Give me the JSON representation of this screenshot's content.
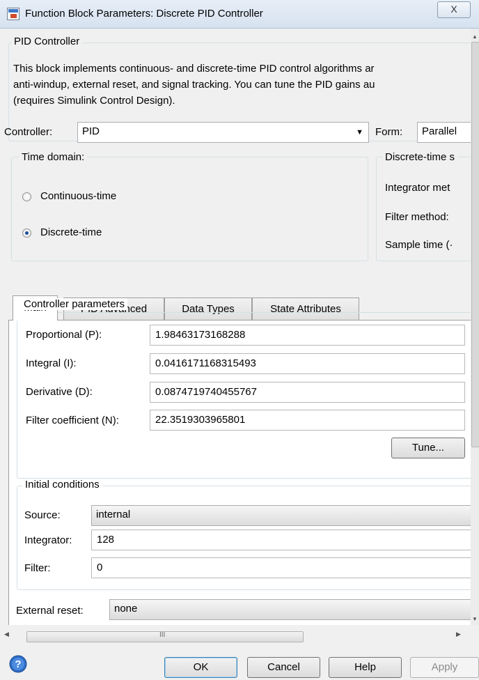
{
  "window": {
    "title": "Function Block Parameters: Discrete PID Controller",
    "close_glyph": "X"
  },
  "header": {
    "group_title": "PID Controller",
    "description_lines": [
      "This block implements continuous- and discrete-time PID control algorithms ar",
      "anti-windup, external reset, and signal tracking. You can tune the PID gains au",
      "(requires Simulink Control Design)."
    ]
  },
  "controller": {
    "label": "Controller:",
    "value": "PID",
    "form_label": "Form:",
    "form_value": "Parallel"
  },
  "time_domain": {
    "title": "Time domain:",
    "options": [
      "Continuous-time",
      "Discrete-time"
    ],
    "selected": "Discrete-time"
  },
  "discrete_time": {
    "title": "Discrete-time s",
    "integrator_method_label": "Integrator met",
    "filter_method_label": "Filter method:",
    "sample_time_label": "Sample time (·"
  },
  "tabs": [
    "Main",
    "PID Advanced",
    "Data Types",
    "State Attributes"
  ],
  "active_tab": "Main",
  "controller_parameters": {
    "title": "Controller parameters",
    "proportional_label": "Proportional (P):",
    "proportional_value": "1.98463173168288",
    "integral_label": "Integral (I):",
    "integral_value": "0.0416171168315493",
    "derivative_label": "Derivative (D):",
    "derivative_value": "0.0874719740455767",
    "filter_label": "Filter coefficient (N):",
    "filter_value": "22.3519303965801",
    "tune_label": "Tune..."
  },
  "initial_conditions": {
    "title": "Initial conditions",
    "source_label": "Source:",
    "source_value": "internal",
    "integrator_label": "Integrator:",
    "integrator_value": "128",
    "filter_label": "Filter:",
    "filter_value": "0"
  },
  "external_reset": {
    "label": "External reset:",
    "value": "none"
  },
  "hscroll": {
    "thumb_glyph": "III"
  },
  "buttons": {
    "ok": "OK",
    "cancel": "Cancel",
    "help": "Help",
    "apply": "Apply"
  },
  "colors": {
    "title_bar": "#dce6f2",
    "panel_bg": "#f0f0f0",
    "help_icon": "#2f6cc4"
  },
  "icons": [
    "simulink-block-icon",
    "radio-icon",
    "dropdown-arrow-icon",
    "scroll-arrow-icon",
    "help-icon"
  ]
}
